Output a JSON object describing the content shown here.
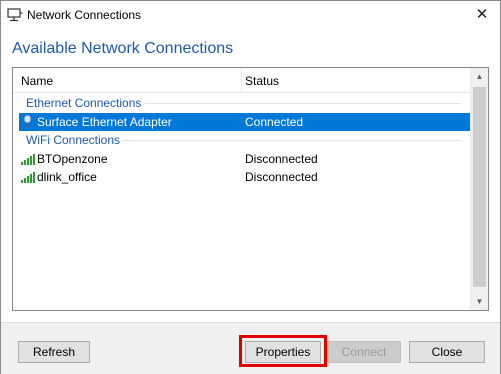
{
  "window": {
    "title": "Network Connections",
    "close_glyph": "✕",
    "title_icon": "network-monitor-icon"
  },
  "heading": "Available Network Connections",
  "list": {
    "columns": {
      "name": "Name",
      "status": "Status"
    },
    "groups": [
      {
        "label": "Ethernet Connections",
        "items": [
          {
            "name": "Surface Ethernet Adapter",
            "status": "Connected",
            "icon": "ethernet-plug-icon",
            "selected": true
          }
        ]
      },
      {
        "label": "WiFi Connections",
        "items": [
          {
            "name": "BTOpenzone",
            "status": "Disconnected",
            "icon": "wifi-signal-icon",
            "selected": false
          },
          {
            "name": "dlink_office",
            "status": "Disconnected",
            "icon": "wifi-signal-icon",
            "selected": false
          }
        ]
      }
    ]
  },
  "buttons": {
    "refresh": "Refresh",
    "properties": "Properties",
    "connect": "Connect",
    "close": "Close"
  },
  "colors": {
    "accent": "#1e5aa8",
    "selection": "#0078d7",
    "highlight_box": "#e00000"
  }
}
